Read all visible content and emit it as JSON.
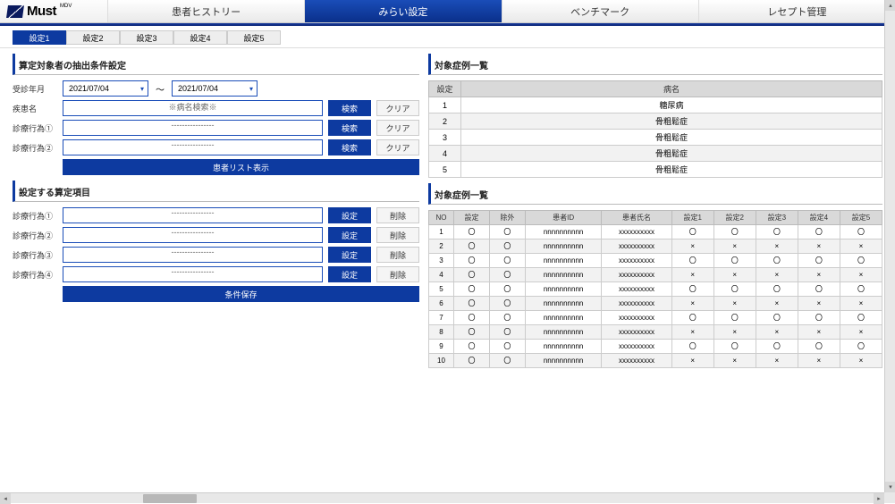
{
  "logo": {
    "text": "Must",
    "sup": "MDV"
  },
  "main_tabs": [
    "患者ヒストリー",
    "みらい設定",
    "ベンチマーク",
    "レセプト管理"
  ],
  "main_active": 1,
  "sub_tabs": [
    "設定1",
    "設定2",
    "設定3",
    "設定4",
    "設定5"
  ],
  "sub_active": 0,
  "left": {
    "section1_title": "算定対象者の抽出条件設定",
    "date_label": "受診年月",
    "date_from": "2021/07/04",
    "date_to": "2021/07/04",
    "rows": [
      {
        "label": "疾患名",
        "placeholder": "※病名検索※",
        "search": "検索",
        "clear": "クリア"
      },
      {
        "label": "診療行為①",
        "placeholder": "----------------",
        "search": "検索",
        "clear": "クリア"
      },
      {
        "label": "診療行為②",
        "placeholder": "----------------",
        "search": "検索",
        "clear": "クリア"
      }
    ],
    "show_list": "患者リスト表示",
    "section2_title": "設定する算定項目",
    "calc_rows": [
      {
        "label": "診療行為①",
        "placeholder": "----------------",
        "set": "設定",
        "del": "削除"
      },
      {
        "label": "診療行為②",
        "placeholder": "----------------",
        "set": "設定",
        "del": "削除"
      },
      {
        "label": "診療行為③",
        "placeholder": "----------------",
        "set": "設定",
        "del": "削除"
      },
      {
        "label": "診療行為④",
        "placeholder": "----------------",
        "set": "設定",
        "del": "削除"
      }
    ],
    "save": "条件保存"
  },
  "right": {
    "case_title": "対象症例一覧",
    "case_headers": [
      "設定",
      "病名"
    ],
    "cases": [
      {
        "idx": "1",
        "name": "糖尿病"
      },
      {
        "idx": "2",
        "name": "骨粗鬆症"
      },
      {
        "idx": "3",
        "name": "骨粗鬆症"
      },
      {
        "idx": "4",
        "name": "骨粗鬆症"
      },
      {
        "idx": "5",
        "name": "骨粗鬆症"
      }
    ],
    "pt_title": "対象症例一覧",
    "pt_headers": [
      "NO",
      "設定",
      "除外",
      "患者ID",
      "患者氏名",
      "設定1",
      "設定2",
      "設定3",
      "設定4",
      "設定5"
    ],
    "patients": [
      {
        "no": "1",
        "set": "〇",
        "ex": "〇",
        "id": "nnnnnnnnnn",
        "nm": "xxxxxxxxxx",
        "c": [
          "〇",
          "〇",
          "〇",
          "〇",
          "〇"
        ]
      },
      {
        "no": "2",
        "set": "〇",
        "ex": "〇",
        "id": "nnnnnnnnnn",
        "nm": "xxxxxxxxxx",
        "c": [
          "×",
          "×",
          "×",
          "×",
          "×"
        ]
      },
      {
        "no": "3",
        "set": "〇",
        "ex": "〇",
        "id": "nnnnnnnnnn",
        "nm": "xxxxxxxxxx",
        "c": [
          "〇",
          "〇",
          "〇",
          "〇",
          "〇"
        ]
      },
      {
        "no": "4",
        "set": "〇",
        "ex": "〇",
        "id": "nnnnnnnnnn",
        "nm": "xxxxxxxxxx",
        "c": [
          "×",
          "×",
          "×",
          "×",
          "×"
        ]
      },
      {
        "no": "5",
        "set": "〇",
        "ex": "〇",
        "id": "nnnnnnnnnn",
        "nm": "xxxxxxxxxx",
        "c": [
          "〇",
          "〇",
          "〇",
          "〇",
          "〇"
        ]
      },
      {
        "no": "6",
        "set": "〇",
        "ex": "〇",
        "id": "nnnnnnnnnn",
        "nm": "xxxxxxxxxx",
        "c": [
          "×",
          "×",
          "×",
          "×",
          "×"
        ]
      },
      {
        "no": "7",
        "set": "〇",
        "ex": "〇",
        "id": "nnnnnnnnnn",
        "nm": "xxxxxxxxxx",
        "c": [
          "〇",
          "〇",
          "〇",
          "〇",
          "〇"
        ]
      },
      {
        "no": "8",
        "set": "〇",
        "ex": "〇",
        "id": "nnnnnnnnnn",
        "nm": "xxxxxxxxxx",
        "c": [
          "×",
          "×",
          "×",
          "×",
          "×"
        ]
      },
      {
        "no": "9",
        "set": "〇",
        "ex": "〇",
        "id": "nnnnnnnnnn",
        "nm": "xxxxxxxxxx",
        "c": [
          "〇",
          "〇",
          "〇",
          "〇",
          "〇"
        ]
      },
      {
        "no": "10",
        "set": "〇",
        "ex": "〇",
        "id": "nnnnnnnnnn",
        "nm": "xxxxxxxxxx",
        "c": [
          "×",
          "×",
          "×",
          "×",
          "×"
        ]
      }
    ]
  }
}
